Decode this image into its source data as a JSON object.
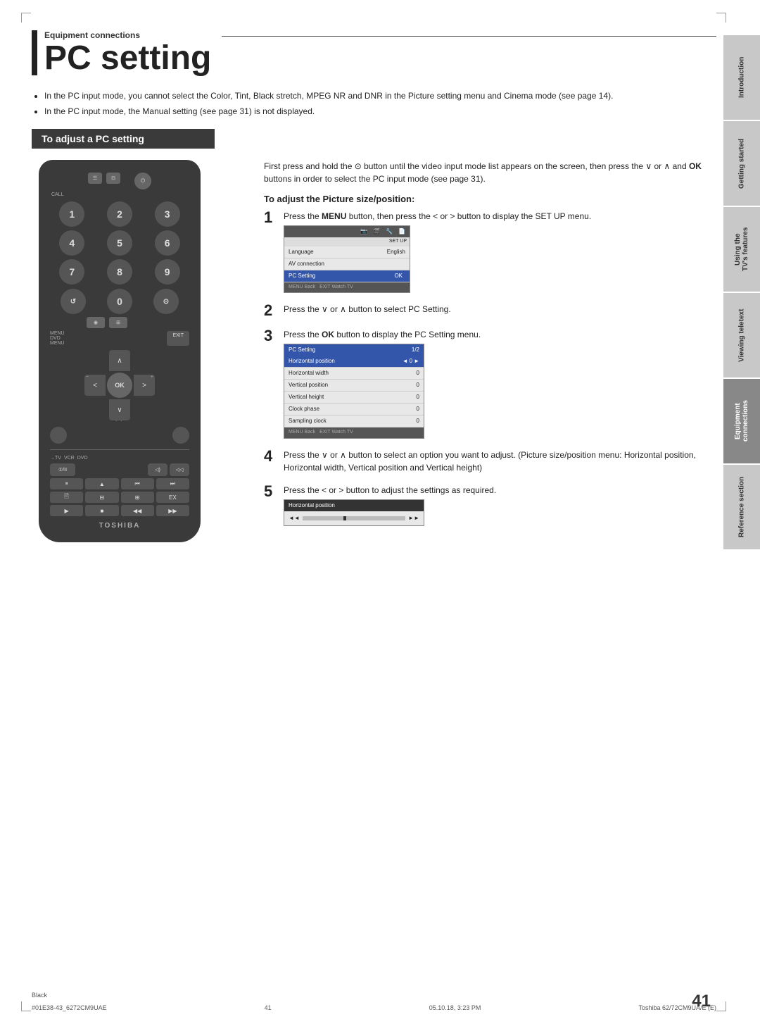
{
  "page": {
    "number": "41",
    "footer_left": "#01E38-43_6272CM9UAE",
    "footer_center": "41",
    "footer_date": "05.10.18, 3:23 PM",
    "footer_right": "Toshiba 62/72CM9UA/E (E)",
    "footer_color": "Black"
  },
  "sidebar": {
    "tabs": [
      {
        "label": "Introduction",
        "active": false
      },
      {
        "label": "Getting started",
        "active": false
      },
      {
        "label": "Using the TV's features",
        "active": false
      },
      {
        "label": "Viewing teletext",
        "active": false
      },
      {
        "label": "Equipment connections",
        "active": true
      },
      {
        "label": "Reference section",
        "active": false
      }
    ]
  },
  "header": {
    "section_label": "Equipment connections",
    "title": "PC setting"
  },
  "bullets": [
    "In the PC input mode, you cannot select the Color, Tint, Black stretch, MPEG NR and DNR in the Picture setting menu and Cinema mode (see page 14).",
    "In the PC input mode, the Manual setting (see page 31) is not displayed."
  ],
  "adjust_section": {
    "title": "To adjust a PC setting",
    "intro": "First press and hold the  button until the video input mode list appears on the screen, then press the  or  and OK buttons in order to select the PC input mode (see page 31).",
    "subsection_title": "To adjust the Picture size/position:",
    "steps": [
      {
        "num": "1",
        "text": "Press the MENU button, then press the  or  button to display the SET UP menu."
      },
      {
        "num": "2",
        "text": "Press the  or  button to select PC Setting."
      },
      {
        "num": "3",
        "text": "Press the OK button to display the PC Setting menu."
      },
      {
        "num": "4",
        "text": "Press the  or  button to select an option you want to adjust. (Picture size/position menu: Horizontal position, Horizontal width, Vertical position and Vertical height)"
      },
      {
        "num": "5",
        "text": "Press the  or  button to adjust the settings as required."
      }
    ],
    "screen1": {
      "title": "SET UP",
      "rows": [
        {
          "label": "Language",
          "value": "English",
          "highlight": false
        },
        {
          "label": "AV connection",
          "value": "",
          "highlight": false
        },
        {
          "label": "PC Setting",
          "value": "OK",
          "highlight": true
        }
      ],
      "footer": "MENU Back  EXIT Watch TV"
    },
    "screen2": {
      "title": "PC Setting",
      "page": "1/2",
      "rows": [
        {
          "label": "Horizontal position",
          "value": "0",
          "active": true
        },
        {
          "label": "Horizontal width",
          "value": "0",
          "active": false
        },
        {
          "label": "Vertical position",
          "value": "0",
          "active": false
        },
        {
          "label": "Vertical height",
          "value": "0",
          "active": false
        },
        {
          "label": "Clock phase",
          "value": "0",
          "active": false
        },
        {
          "label": "Sampling clock",
          "value": "0",
          "active": false
        }
      ],
      "footer": "MENU Back  EXIT Watch TV"
    },
    "screen5": {
      "label": "Horizontal position",
      "value": "0"
    }
  },
  "remote": {
    "brand": "TOSHIBA"
  }
}
